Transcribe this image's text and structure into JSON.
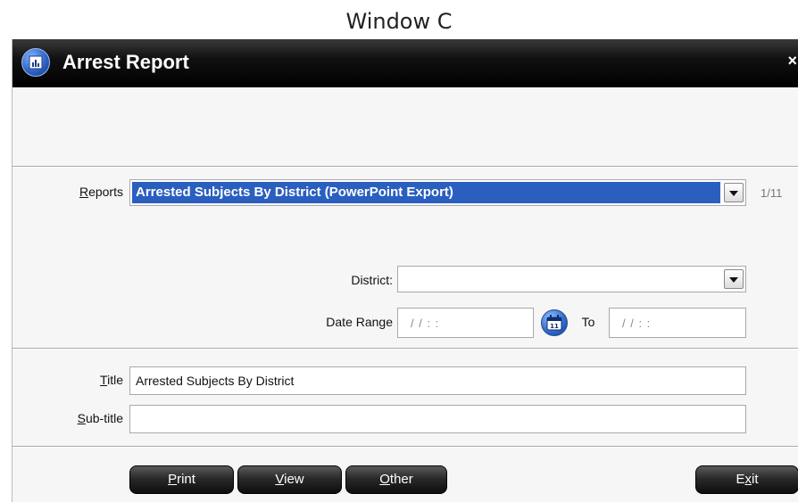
{
  "caption": "Window C",
  "window": {
    "title": "Arrest Report",
    "close": "×"
  },
  "form": {
    "reports": {
      "label_accel": "R",
      "label_rest": "eports",
      "value": "Arrested Subjects By District (PowerPoint Export)",
      "page_count": "1/11"
    },
    "district": {
      "label": "District:",
      "value": ""
    },
    "date_range": {
      "label": "Date Range",
      "from_placeholder": "/ /   : :",
      "to_label": "To",
      "to_placeholder": "/ /   : :"
    },
    "title_field": {
      "label_accel": "T",
      "label_rest": "itle",
      "value": "Arrested Subjects By District"
    },
    "subtitle_field": {
      "label_accel": "S",
      "label_rest": "ub-title",
      "value": ""
    }
  },
  "buttons": {
    "print": {
      "accel": "P",
      "rest": "rint"
    },
    "view": {
      "accel": "V",
      "rest": "iew"
    },
    "other": {
      "accel": "O",
      "rest": "ther"
    },
    "exit": {
      "pre": "E",
      "accel": "x",
      "rest": "it"
    }
  },
  "icons": {
    "app": "report-icon",
    "calendar": "calendar-icon",
    "dropdown": "chevron-down-icon",
    "close": "close-icon"
  },
  "colors": {
    "selection": "#2a5fbf",
    "titlebar": "#000000",
    "button": "#1a1a1a"
  }
}
